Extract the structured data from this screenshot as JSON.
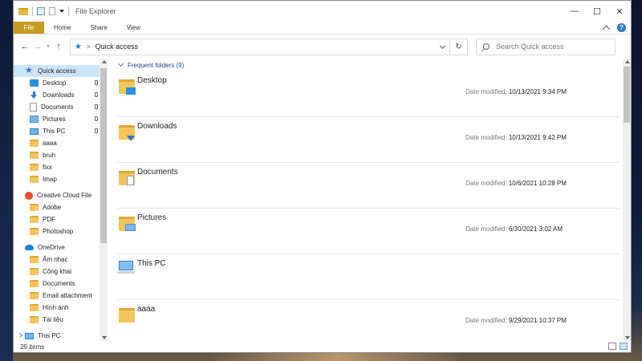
{
  "window": {
    "title": "File Explorer",
    "controls": {
      "minimize": "—",
      "maximize": "☐",
      "close": "✕"
    }
  },
  "ribbon": {
    "tabs": [
      "File",
      "Home",
      "Share",
      "View"
    ],
    "help": "?"
  },
  "address": {
    "path_separator": ">",
    "location": "Quick access",
    "search_placeholder": "Search Quick access"
  },
  "nav_buttons": {
    "back": "←",
    "forward": "→",
    "recent": "˅",
    "up": "↑",
    "refresh": "↻"
  },
  "sidebar": {
    "quick_access": {
      "label": "Quick access",
      "items": [
        {
          "label": "Desktop",
          "icon": "desktop-icon",
          "pinned": true
        },
        {
          "label": "Downloads",
          "icon": "downloads-icon",
          "pinned": true
        },
        {
          "label": "Documents",
          "icon": "documents-icon",
          "pinned": true
        },
        {
          "label": "Pictures",
          "icon": "pictures-icon",
          "pinned": true
        },
        {
          "label": "This PC",
          "icon": "this-pc-icon",
          "pinned": true
        },
        {
          "label": "aaaa",
          "icon": "folder-icon",
          "pinned": false
        },
        {
          "label": "bruh",
          "icon": "folder-icon",
          "pinned": false
        },
        {
          "label": "fixx",
          "icon": "folder-icon",
          "pinned": false
        },
        {
          "label": "Imap",
          "icon": "folder-icon",
          "pinned": false
        }
      ]
    },
    "creative_cloud": {
      "label": "Creative Cloud File",
      "items": [
        {
          "label": "Adobe"
        },
        {
          "label": "PDF"
        },
        {
          "label": "Photoshop"
        }
      ]
    },
    "onedrive": {
      "label": "OneDrive",
      "items": [
        {
          "label": "Âm nhạc"
        },
        {
          "label": "Công khai"
        },
        {
          "label": "Documents"
        },
        {
          "label": "Email attachment"
        },
        {
          "label": "Hình ảnh"
        },
        {
          "label": "Tài liệu"
        }
      ]
    },
    "this_pc": {
      "label": "This PC"
    }
  },
  "main": {
    "group_header": "Frequent folders (9)",
    "date_label": "Date modified:",
    "folders": [
      {
        "name": "Desktop",
        "date": "10/13/2021 9:34 PM",
        "icon": "desktop-folder-icon"
      },
      {
        "name": "Downloads",
        "date": "10/13/2021 9:42 PM",
        "icon": "downloads-folder-icon"
      },
      {
        "name": "Documents",
        "date": "10/6/2021 10:28 PM",
        "icon": "documents-folder-icon"
      },
      {
        "name": "Pictures",
        "date": "6/30/2021 3:02 AM",
        "icon": "pictures-folder-icon"
      },
      {
        "name": "This PC",
        "date": "",
        "icon": "this-pc-icon"
      },
      {
        "name": "aaaa",
        "date": "9/29/2021 10:37 PM",
        "icon": "folder-icon"
      }
    ]
  },
  "status": {
    "item_count": "29 items"
  },
  "colors": {
    "accent": "#2b78d0",
    "file_tab": "#c79a21",
    "selection": "#cce4f7",
    "group_header": "#1e3f8f"
  }
}
